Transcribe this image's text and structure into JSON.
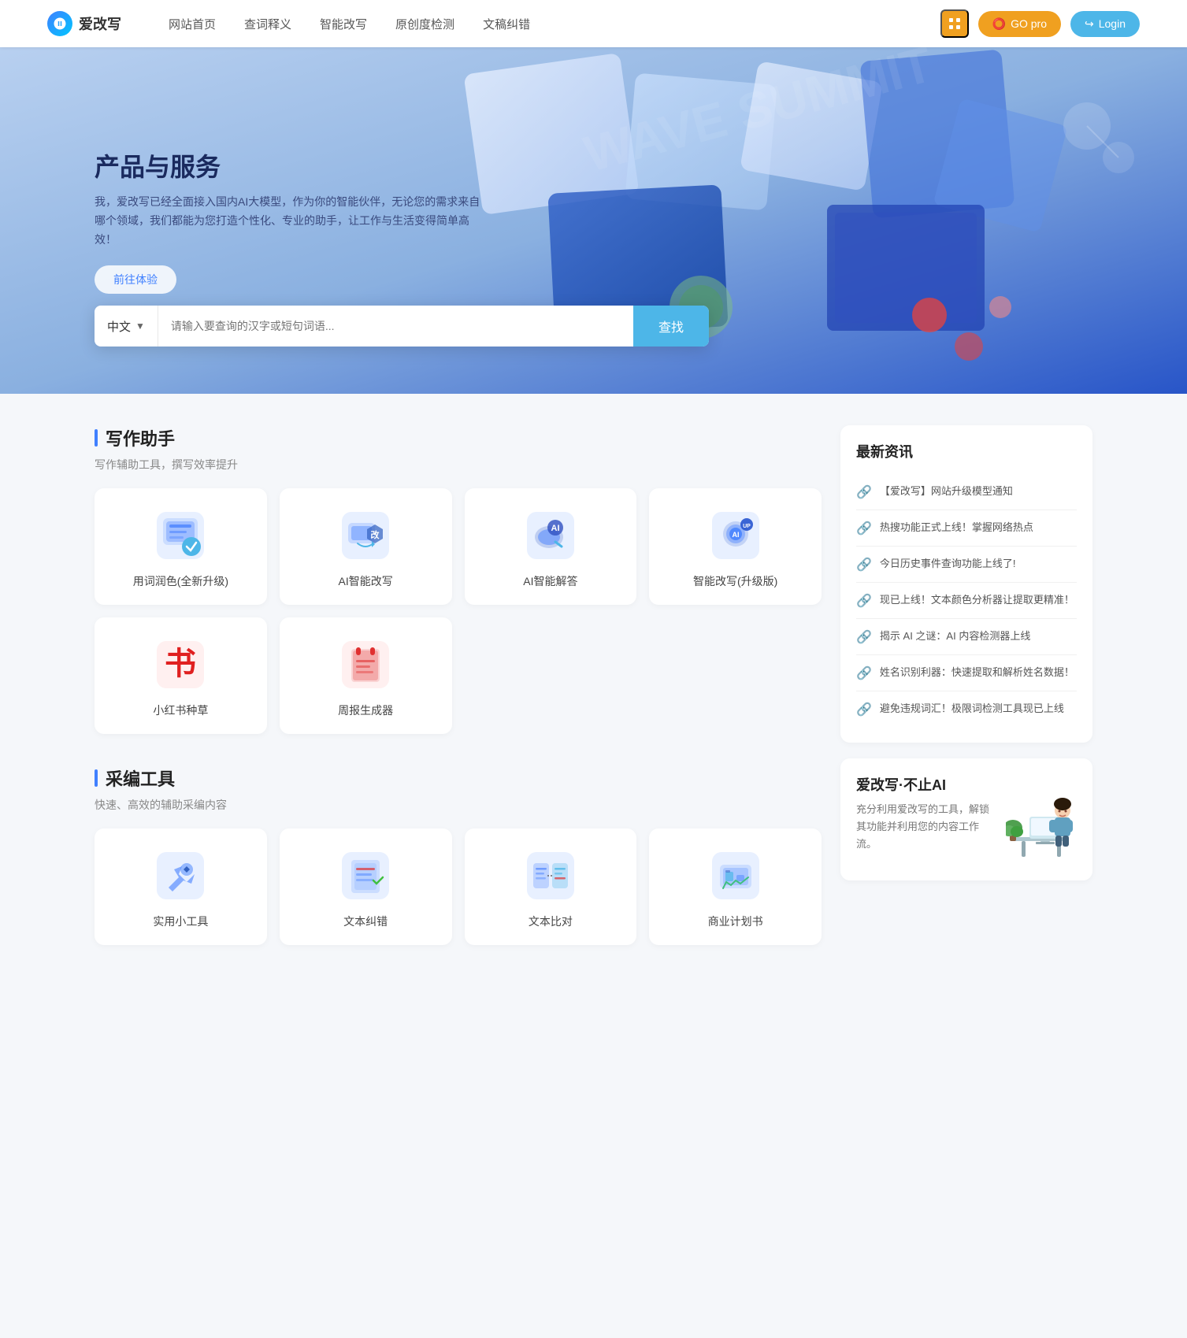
{
  "header": {
    "logo_text": "爱改写",
    "nav": [
      {
        "label": "网站首页",
        "id": "home"
      },
      {
        "label": "查词释义",
        "id": "dict"
      },
      {
        "label": "智能改写",
        "id": "rewrite"
      },
      {
        "label": "原创度检测",
        "id": "check"
      },
      {
        "label": "文稿纠错",
        "id": "proofread"
      }
    ],
    "btn_grid_label": "grid",
    "btn_go_pro_label": "GO pro",
    "btn_login_label": "Login"
  },
  "hero": {
    "title": "产品与服务",
    "description": "我，爱改写已经全面接入国内AI大模型，作为你的智能伙伴，无论您的需求来自哪个领域，我们都能为您打造个性化、专业的助手，让工作与生活变得简单高效！",
    "btn_experience": "前往体验",
    "search": {
      "lang_label": "中文",
      "placeholder": "请输入要查询的汉字或短句词语...",
      "btn_label": "查找"
    }
  },
  "writing_section": {
    "title": "写作助手",
    "desc": "写作辅助工具，撰写效率提升",
    "cards": [
      {
        "label": "用词润色(全新升级)",
        "icon_type": "writing"
      },
      {
        "label": "AI智能改写",
        "icon_type": "rewrite"
      },
      {
        "label": "AI智能解答",
        "icon_type": "ai-answer"
      },
      {
        "label": "智能改写(升级版)",
        "icon_type": "smart-rewrite"
      },
      {
        "label": "小红书种草",
        "icon_type": "red-book"
      },
      {
        "label": "周报生成器",
        "icon_type": "weekly"
      }
    ]
  },
  "tool_section": {
    "title": "采编工具",
    "desc": "快速、高效的辅助采编内容",
    "cards": [
      {
        "label": "实用小工具",
        "icon_type": "tools"
      },
      {
        "label": "文本纠错",
        "icon_type": "text-error"
      },
      {
        "label": "文本比对",
        "icon_type": "text-compare"
      },
      {
        "label": "商业计划书",
        "icon_type": "business-plan"
      }
    ]
  },
  "news": {
    "title": "最新资讯",
    "items": [
      {
        "text": "【爱改写】网站升级模型通知"
      },
      {
        "text": "热搜功能正式上线！掌握网络热点"
      },
      {
        "text": "今日历史事件查询功能上线了!"
      },
      {
        "text": "现已上线！文本颜色分析器让提取更精准！"
      },
      {
        "text": "揭示 AI 之谜：AI 内容检测器上线"
      },
      {
        "text": "姓名识别利器：快速提取和解析姓名数据！"
      },
      {
        "text": "避免违规词汇！极限词检测工具现已上线"
      }
    ]
  },
  "promo": {
    "title": "爱改写·不止AI",
    "desc": "充分利用爱改写的工具，解锁其功能并利用您的内容工作流。"
  }
}
